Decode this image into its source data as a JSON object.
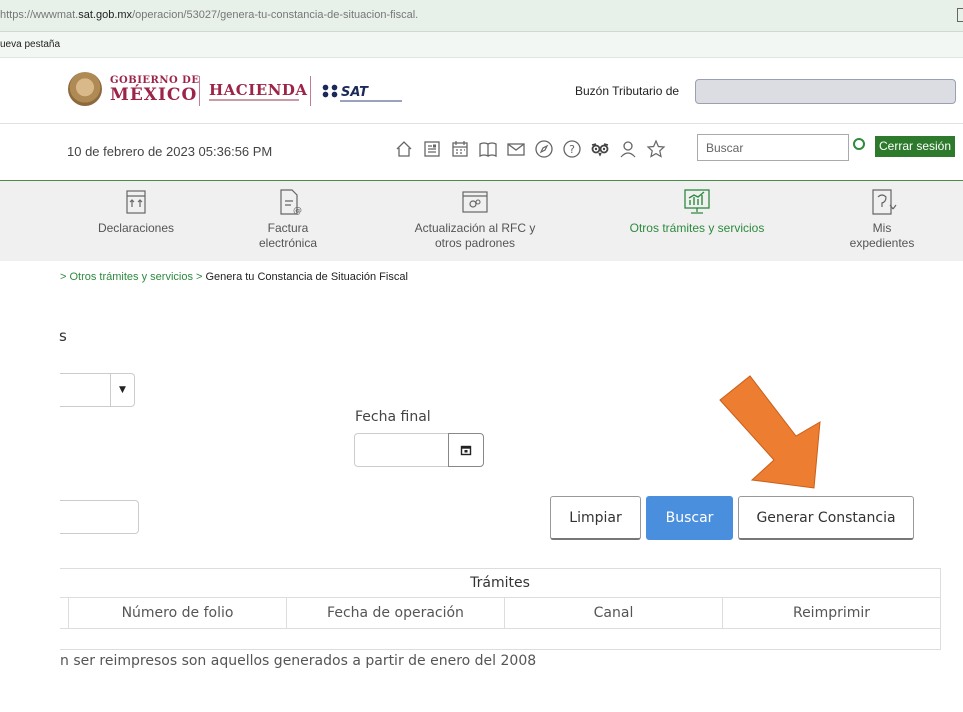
{
  "browser": {
    "url_prefix": "https://wwwmat.",
    "url_domain": "sat.gob.mx",
    "url_path": "/operacion/53027/genera-tu-constancia-de-situacion-fiscal.",
    "bookmark_fragment": "ueva pestaña"
  },
  "gov_header": {
    "gobierno_line1": "GOBIERNO DE",
    "gobierno_line2": "MÉXICO",
    "hacienda": "HACIENDA",
    "sat": "SAT",
    "buzon_label": "Buzón Tributario de"
  },
  "tools": {
    "datetime": "10 de febrero de 2023 05:36:56 PM",
    "search_placeholder": "Buscar",
    "logout_label": "Cerrar sesión"
  },
  "nav": {
    "items": [
      {
        "label": "Declaraciones",
        "icon": "declarations-icon"
      },
      {
        "label": "Factura electrónica",
        "icon": "invoice-icon"
      },
      {
        "label": "Actualización al RFC y otros padrones",
        "icon": "rfc-settings-icon"
      },
      {
        "label": "Otros trámites y servicios",
        "icon": "services-chart-icon",
        "active": true
      },
      {
        "label": "Mis expedientes",
        "icon": "records-icon"
      }
    ]
  },
  "breadcrumb": {
    "link": "> Otros trámites y servicios >",
    "current": " Genera tu Constancia de Situación Fiscal"
  },
  "form": {
    "section_fragment": "s",
    "fecha_final_label": "Fecha final",
    "buttons": {
      "limpiar": "Limpiar",
      "buscar": "Buscar",
      "generar": "Generar Constancia"
    }
  },
  "table": {
    "title": "Trámites",
    "columns": [
      "Número de folio",
      "Fecha de operación",
      "Canal",
      "Reimprimir"
    ]
  },
  "footnote": "n ser reimpresos son aquellos generados a partir de enero del 2008",
  "colors": {
    "accent_green": "#2d8a3e",
    "gov_maroon": "#9d2449",
    "primary_blue": "#4a8fdd",
    "annotation_orange": "#ed7d31"
  }
}
